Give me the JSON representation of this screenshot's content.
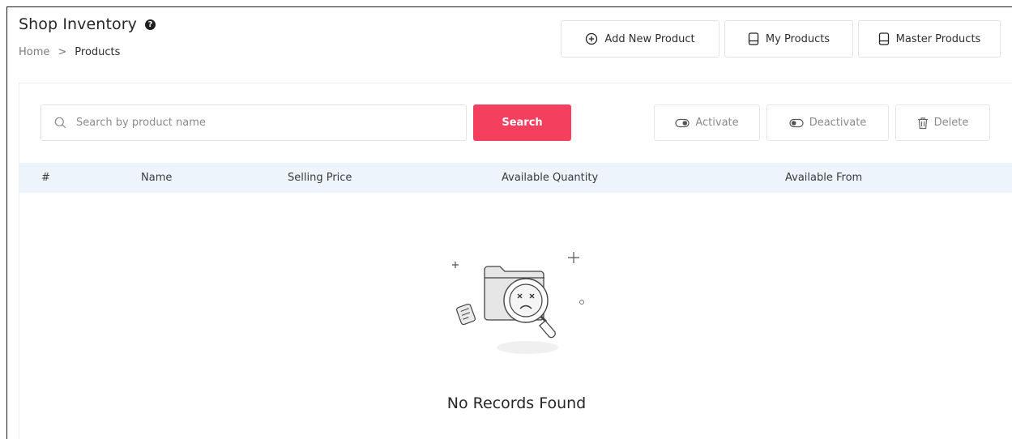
{
  "header": {
    "title": "Shop Inventory",
    "help_icon": "help-circle-icon"
  },
  "breadcrumb": {
    "home": "Home",
    "separator": ">",
    "current": "Products"
  },
  "top_actions": {
    "add_new_product": "Add New Product",
    "my_products": "My Products",
    "master_products": "Master Products"
  },
  "toolbar": {
    "search_placeholder": "Search by product name",
    "search_value": "",
    "search_button": "Search",
    "activate": "Activate",
    "deactivate": "Deactivate",
    "delete": "Delete"
  },
  "table": {
    "columns": [
      "#",
      "Name",
      "Selling Price",
      "Available Quantity",
      "Available From"
    ],
    "rows": []
  },
  "empty_state": {
    "message": "No Records Found",
    "illustration": "empty-folder-search-icon"
  },
  "colors": {
    "accent": "#f43f5e",
    "header_row": "#eef4fc"
  }
}
